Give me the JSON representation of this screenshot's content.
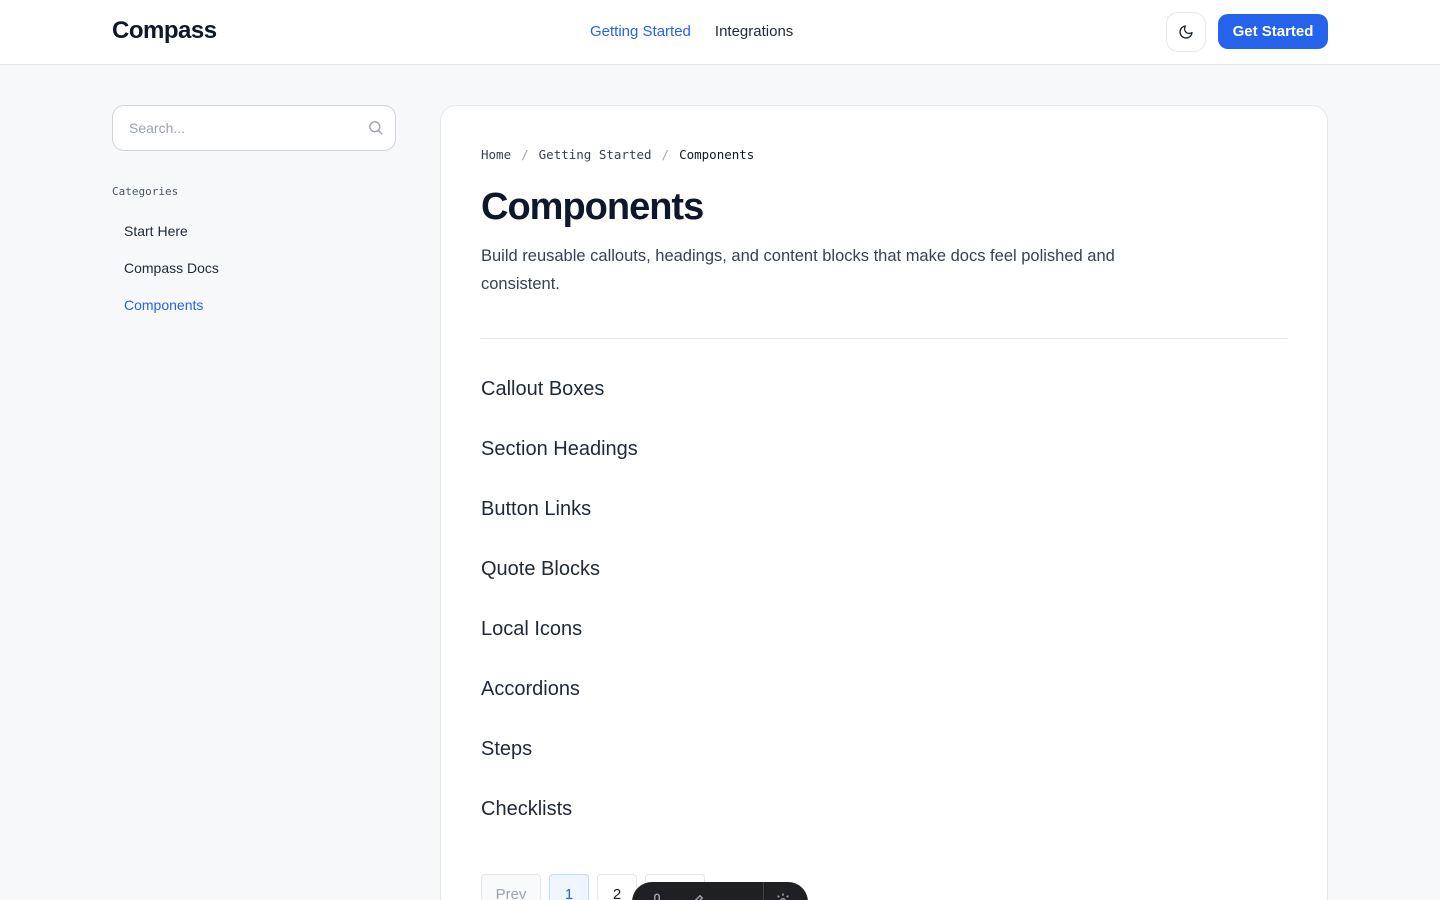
{
  "header": {
    "logo": "Compass",
    "nav": [
      {
        "label": "Getting Started",
        "active": true
      },
      {
        "label": "Integrations",
        "active": false
      }
    ],
    "theme_toggle_icon": "moon-icon",
    "cta_label": "Get Started"
  },
  "sidebar": {
    "search_placeholder": "Search...",
    "search_icon": "search-icon",
    "categories_label": "Categories",
    "items": [
      {
        "label": "Start Here",
        "active": false
      },
      {
        "label": "Compass Docs",
        "active": false
      },
      {
        "label": "Components",
        "active": true
      }
    ]
  },
  "main": {
    "breadcrumb": [
      "Home",
      "Getting Started",
      "Components"
    ],
    "title": "Components",
    "description": "Build reusable callouts, headings, and content blocks that make docs feel polished and consistent.",
    "sections": [
      "Callout Boxes",
      "Section Headings",
      "Button Links",
      "Quote Blocks",
      "Local Icons",
      "Accordions",
      "Steps",
      "Checklists"
    ],
    "pagination": {
      "prev_label": "Prev",
      "pages": [
        "1",
        "2"
      ],
      "current_page": "1"
    }
  },
  "colors": {
    "accent": "#2563eb",
    "page_bg": "#f7f8fa",
    "card_bg": "#ffffff",
    "text": "#111827",
    "toolbar_bg": "#1f2023"
  }
}
